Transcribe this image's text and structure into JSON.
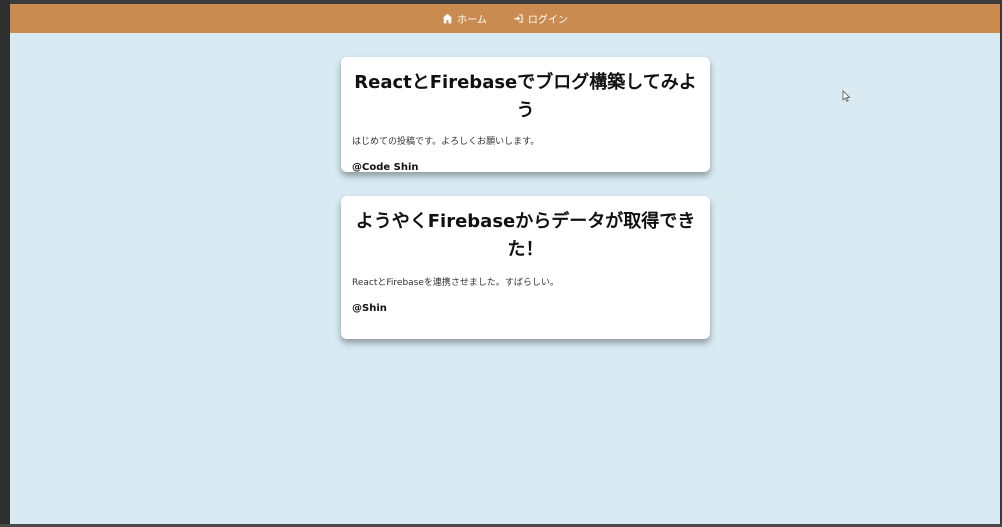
{
  "nav": {
    "home_label": "ホーム",
    "login_label": "ログイン",
    "background_color": "#c98b4f",
    "home_icon": "home-icon",
    "login_icon": "sign-in-icon"
  },
  "posts": [
    {
      "title": "ReactとFirebaseでブログ構築してみよう",
      "text": "はじめての投稿です。よろしくお願いします。",
      "author": "@Code Shin"
    },
    {
      "title": "ようやくFirebaseからデータが取得できた！",
      "text": "ReactとFirebaseを連携させました。すばらしい。",
      "author": "@Shin"
    }
  ],
  "colors": {
    "page_background": "#d9eaf3",
    "card_background": "#ffffff"
  }
}
